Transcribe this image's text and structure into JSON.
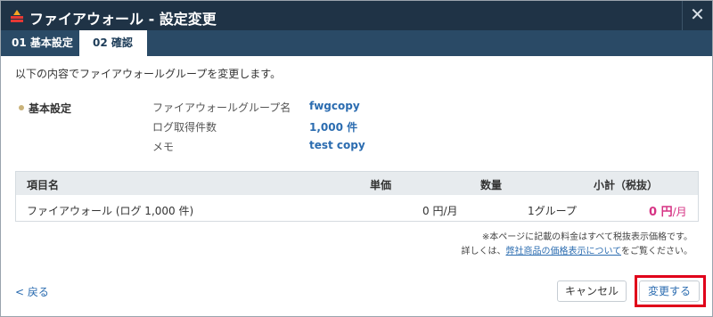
{
  "dialog": {
    "title": "ファイアウォール - 設定変更",
    "close_symbol": "✕",
    "icon": "firewall-app-icon",
    "tabs": [
      {
        "label": "01 基本設定",
        "active": false
      },
      {
        "label": "02 確認",
        "active": true
      }
    ]
  },
  "intro": "以下の内容でファイアウォールグループを変更します。",
  "basic_settings": {
    "section_label": "基本設定",
    "rows": [
      {
        "label": "ファイアウォールグループ名",
        "value": "fwgcopy"
      },
      {
        "label": "ログ取得件数",
        "value": "1,000 件"
      },
      {
        "label": "メモ",
        "value": "test copy"
      }
    ]
  },
  "table": {
    "headers": [
      "項目名",
      "単価",
      "数量",
      "小計（税抜）"
    ],
    "rows": [
      {
        "item": "ファイアウォール (ログ 1,000 件)",
        "unit_price": "0 円/月",
        "quantity": "1グループ",
        "subtotal_amount": "0 円",
        "subtotal_unit": "/月"
      }
    ]
  },
  "notes": {
    "line1": "※本ページに記載の料金はすべて税抜表示価格です。",
    "line2_prefix": "詳しくは、",
    "line2_link": "弊社商品の価格表示について",
    "line2_suffix": "をご覧ください。"
  },
  "footer": {
    "back_label": "< 戻る",
    "cancel_label": "キャンセル",
    "submit_label": "変更する"
  },
  "colors": {
    "titlebar": "#1f3346",
    "tabbar": "#2a4a66",
    "link": "#2b6cb0",
    "price": "#d63384",
    "highlight": "#e0001a"
  }
}
